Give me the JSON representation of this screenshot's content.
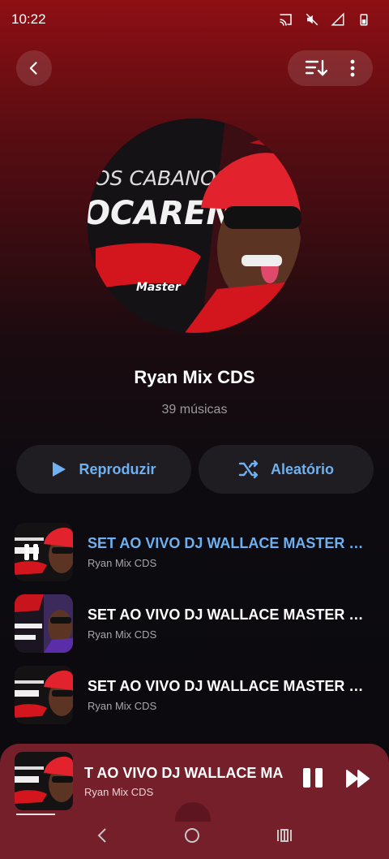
{
  "status_bar": {
    "time": "10:22"
  },
  "header": {
    "back_icon": "chevron-left-icon",
    "sort_icon": "sort-icon",
    "more_icon": "more-vertical-icon"
  },
  "cover": {
    "text_line1": "OS CABANOS",
    "text_line2": "OCARENA",
    "text_line3": "Master"
  },
  "playlist": {
    "title": "Ryan Mix CDS",
    "count": "39 músicas"
  },
  "actions": {
    "play_label": "Reproduzir",
    "shuffle_label": "Aleatório"
  },
  "tracks": [
    {
      "title": "SET AO VIVO DJ WALLACE MASTER O...",
      "artist": "Ryan Mix CDS",
      "active": true
    },
    {
      "title": "SET AO VIVO DJ WALLACE MASTER O...",
      "artist": "Ryan Mix CDS",
      "active": false
    },
    {
      "title": "SET AO VIVO DJ WALLACE MASTER O...",
      "artist": "Ryan Mix CDS",
      "active": false
    }
  ],
  "mini_player": {
    "title": "T AO VIVO DJ WALLACE MAST",
    "artist": "Ryan Mix CDS",
    "progress": 0.15
  },
  "colors": {
    "accent": "#6fb1f0",
    "header_red": "#8e0f14",
    "mini_player_bg": "#751f2a"
  }
}
